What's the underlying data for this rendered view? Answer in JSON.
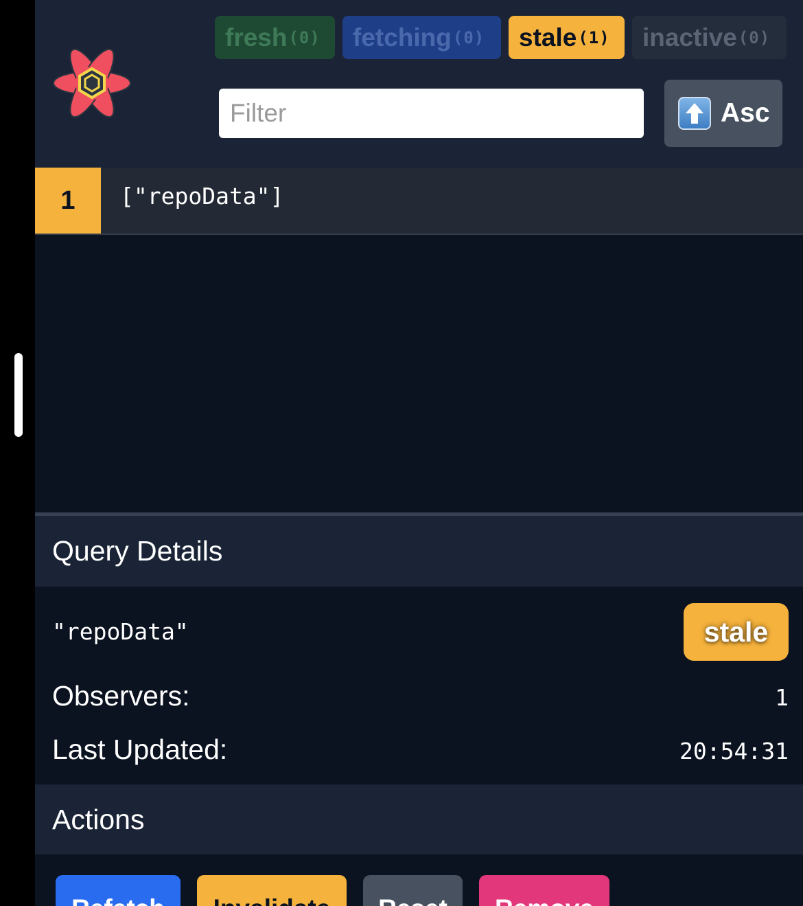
{
  "filters": {
    "fresh": {
      "label": "fresh",
      "count": "(0)"
    },
    "fetching": {
      "label": "fetching",
      "count": "(0)"
    },
    "stale": {
      "label": "stale",
      "count": "(1)"
    },
    "inactive": {
      "label": "inactive",
      "count": "(0)"
    }
  },
  "search": {
    "placeholder": "Filter",
    "value": ""
  },
  "sort": {
    "label": "Asc",
    "icon": "up-arrow-icon"
  },
  "queries": [
    {
      "observers": "1",
      "key": "[\"repoData\"]",
      "status": "stale"
    }
  ],
  "details": {
    "title": "Query Details",
    "query_key": "\"repoData\"",
    "status": "stale",
    "observers_label": "Observers:",
    "observers_value": "1",
    "last_updated_label": "Last Updated:",
    "last_updated_value": "20:54:31"
  },
  "actions": {
    "title": "Actions",
    "refetch": "Refetch",
    "invalidate": "Invalidate",
    "reset": "Reset",
    "remove": "Remove"
  },
  "colors": {
    "panel_bg": "#0b1220",
    "header_bg": "#1a2436",
    "stale": "#f5b23c",
    "fresh": "#1e4a33",
    "fetching": "#1f3e88",
    "inactive": "#242d3c",
    "refetch": "#2a6cf0",
    "reset": "#47515f",
    "remove": "#e3377b"
  }
}
